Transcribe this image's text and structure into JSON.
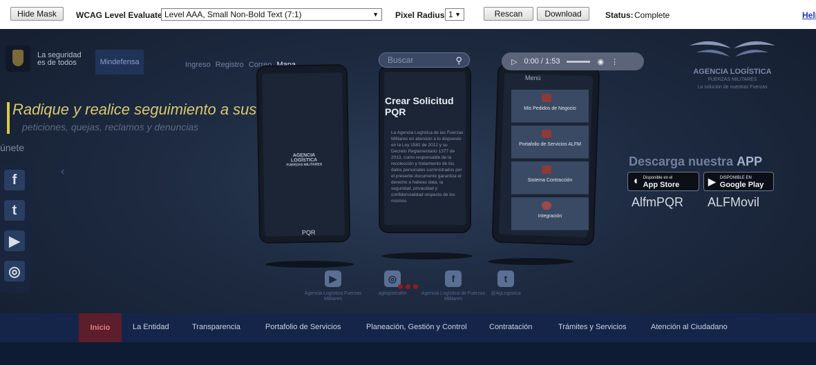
{
  "toolbar": {
    "hide_mask_label": "Hide Mask",
    "wcag_label": "WCAG Level Evaluated:",
    "wcag_value": "Level AAA, Small Non-Bold Text (7:1)",
    "pixel_radius_label": "Pixel Radius:",
    "pixel_radius_value": "1",
    "rescan_label": "Rescan",
    "download_label": "Download",
    "status_label": "Status:",
    "status_value": "Complete",
    "help_label": "Help"
  },
  "site": {
    "gov_text_1": "La seguridad",
    "gov_text_2": "es de todos",
    "mindefensa": "Mindefensa",
    "header_links": [
      "Ingreso",
      "Registro",
      "Correo",
      "Mapa"
    ],
    "hero_title": "Radique y realice seguimiento a sus",
    "hero_subtitle": "peticiones, quejas, reclamos y denuncias",
    "unete": "únete",
    "rail_icons": [
      {
        "icon": "facebook-icon",
        "glyph": "f"
      },
      {
        "icon": "twitter-icon",
        "glyph": "t"
      },
      {
        "icon": "youtube-icon",
        "glyph": "▶"
      },
      {
        "icon": "instagram-icon",
        "glyph": "◎"
      }
    ],
    "search_placeholder": "Buscar",
    "player": {
      "play": "▷",
      "time": "0:00 / 1:53",
      "volume": "◉",
      "more": "⋮"
    },
    "phone1_label": "PQR",
    "phone_logo_text": "AGENCIA LOGÍSTICA",
    "phone_logo_sub": "FUERZAS MILITARES",
    "pqr_title": "Crear Solicitud PQR",
    "pqr_body": "La Agencia Logística de las Fuerzas Militares en atención a lo dispuesto en la Ley 1581 de 2012 y su Decreto Reglamentario 1377 de 2013, como responsable de la recolección y tratamiento de los datos personales suministrados por el presente documento garantiza el derecho a habeas data, la seguridad, privacidad y confidencialidad respecto de los mismos",
    "menu_title": "Menú",
    "menu_cards": [
      "Mis Pedidos de Negocio",
      "Portafolio de Servicios ALFM",
      "Sistema Contracción",
      "Integración"
    ],
    "alf_name": "AGENCIA LOGÍSTICA",
    "alf_sub": "FUERZAS MILITARES",
    "alf_tag": "La solución de nuestras Fuerzas",
    "download_app": "Descarga nuestra",
    "download_app_bold": "APP",
    "app_store": "App Store",
    "app_store_small": "Disponible en el",
    "google_play": "Google Play",
    "google_play_small": "DISPONIBLE EN",
    "app_name_1": "AlfmPQR",
    "app_name_2": "ALFMovil",
    "social_footer": [
      {
        "icon": "youtube-icon",
        "glyph": "▶",
        "text": "Agencia Logística Fuerzas Militares"
      },
      {
        "icon": "instagram-icon",
        "glyph": "◎",
        "text": "aglogisticafm"
      },
      {
        "icon": "facebook-icon",
        "glyph": "f",
        "text": "Agencia Logística de Fuerzas Militares"
      },
      {
        "icon": "twitter-icon",
        "glyph": "t",
        "text": "@AgLogistica"
      }
    ],
    "nav": [
      "Inicio",
      "La Entidad",
      "Transparencia",
      "Portafolio de Servicios",
      "Planeación, Gestión y Control",
      "Contratación",
      "Trámites y Servicios",
      "Atención al Ciudadano"
    ]
  },
  "colors": {
    "site_bg": "#1d2a40",
    "navbar_bg": "#15254a",
    "nav_active_bg": "#5b1e2a",
    "hero_text": "#d9c970",
    "help_link": "#1a2fd0"
  }
}
